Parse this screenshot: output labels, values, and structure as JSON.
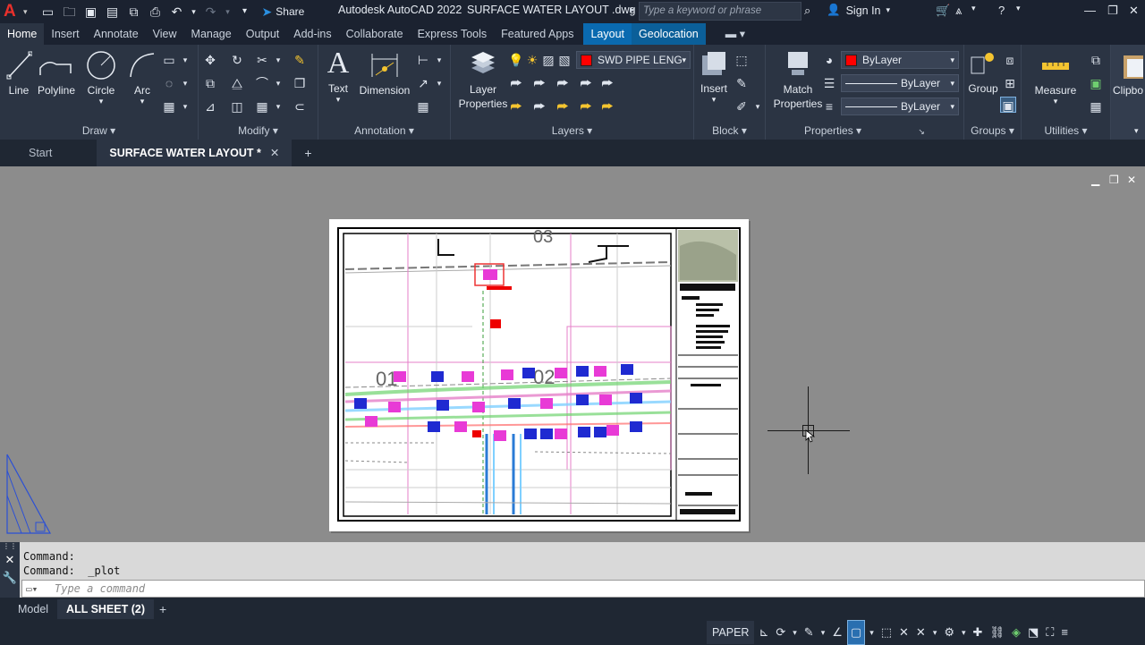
{
  "app": {
    "title": "Autodesk AutoCAD 2022",
    "file": "SURFACE WATER LAYOUT .dwg",
    "share_label": "Share",
    "search_placeholder": "Type a keyword or phrase",
    "signin_label": "Sign In"
  },
  "ribbon_tabs": [
    "Home",
    "Insert",
    "Annotate",
    "View",
    "Manage",
    "Output",
    "Add-ins",
    "Collaborate",
    "Express Tools",
    "Featured Apps",
    "Layout",
    "Geolocation"
  ],
  "ribbon": {
    "draw": {
      "title": "Draw",
      "line": "Line",
      "polyline": "Polyline",
      "circle": "Circle",
      "arc": "Arc"
    },
    "modify": {
      "title": "Modify"
    },
    "annotation": {
      "title": "Annotation",
      "text": "Text",
      "dimension": "Dimension"
    },
    "layers": {
      "title": "Layers",
      "layer_properties": "Layer Properties",
      "current_layer": "SWD PIPE LENG"
    },
    "block": {
      "title": "Block",
      "insert": "Insert"
    },
    "properties": {
      "title": "Properties",
      "match": "Match Properties",
      "color": "ByLayer",
      "linetype": "ByLayer",
      "lineweight": "ByLayer"
    },
    "groups": {
      "title": "Groups",
      "group": "Group"
    },
    "utilities": {
      "title": "Utilities",
      "measure": "Measure"
    },
    "clipboard": {
      "label": "Clipbo"
    }
  },
  "doc_tabs": {
    "start": "Start",
    "active": "SURFACE WATER LAYOUT *"
  },
  "drawing": {
    "sheet_labels": [
      "03",
      "01",
      "02"
    ]
  },
  "command": {
    "history": [
      "Command:",
      "Command:  _plot"
    ],
    "placeholder": "Type a command"
  },
  "layout_tabs": {
    "model": "Model",
    "active": "ALL SHEET (2)"
  },
  "status": {
    "space": "PAPER"
  }
}
